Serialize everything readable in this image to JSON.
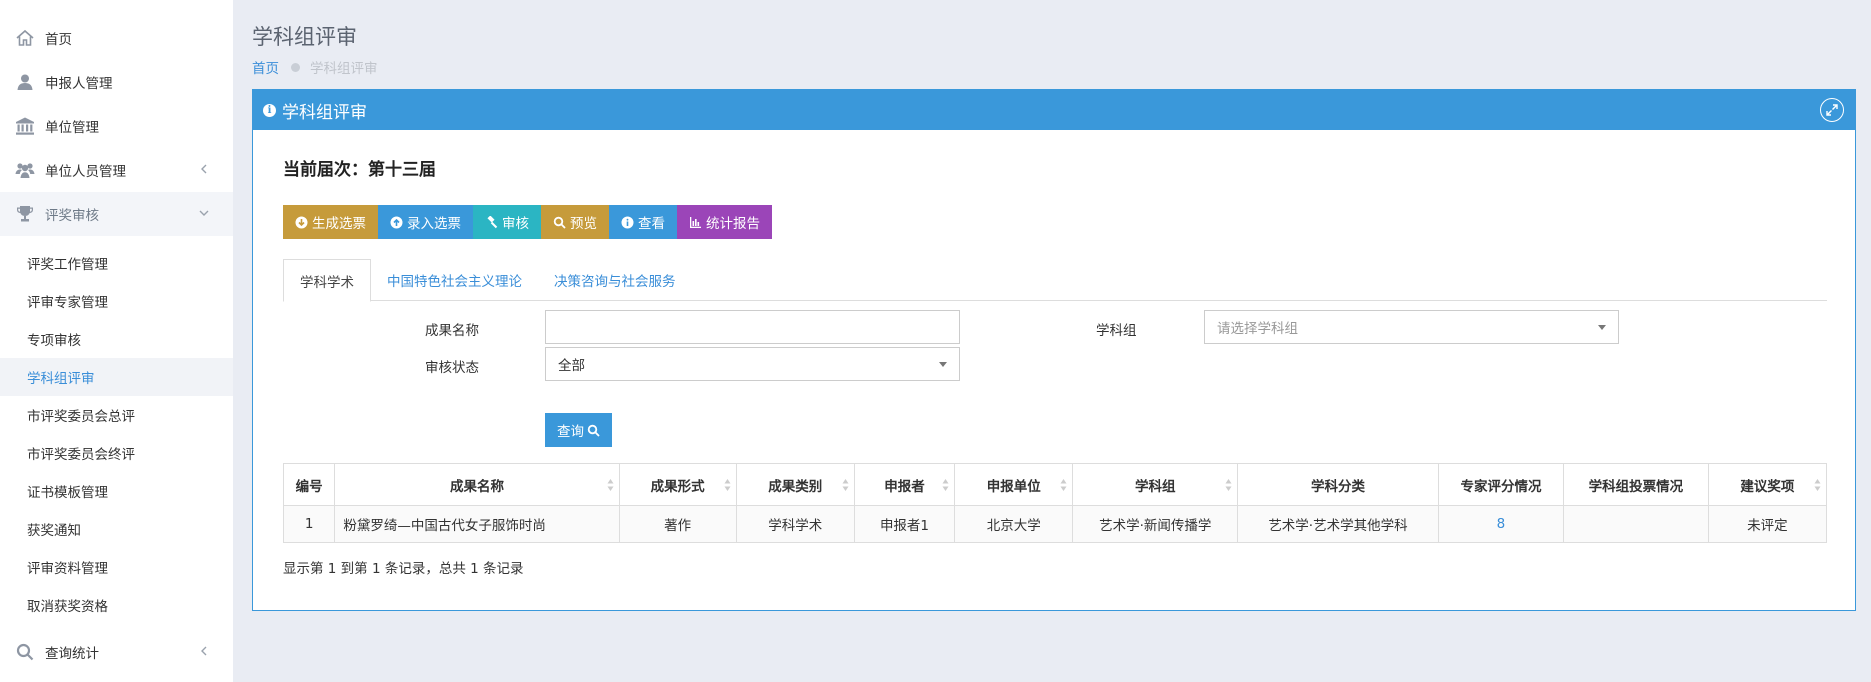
{
  "sidebar": {
    "items": [
      {
        "label": "首页",
        "icon": "home-icon"
      },
      {
        "label": "申报人管理",
        "icon": "user-icon"
      },
      {
        "label": "单位管理",
        "icon": "bank-icon"
      },
      {
        "label": "单位人员管理",
        "icon": "users-icon"
      },
      {
        "label": "评奖审核",
        "icon": "trophy-icon"
      }
    ],
    "sub_items": [
      "评奖工作管理",
      "评审专家管理",
      "专项审核",
      "学科组评审",
      "市评奖委员会总评",
      "市评奖委员会终评",
      "证书模板管理",
      "获奖通知",
      "评审资料管理",
      "取消获奖资格"
    ],
    "bottom_item": {
      "label": "查询统计",
      "icon": "search-icon"
    }
  },
  "header": {
    "title": "学科组评审",
    "breadcrumb_home": "首页",
    "breadcrumb_current": "学科组评审"
  },
  "panel": {
    "title": "学科组评审",
    "round_text": "当前届次：第十三届",
    "buttons": [
      "生成选票",
      "录入选票",
      "审核",
      "预览",
      "查看",
      "统计报告"
    ],
    "tabs": [
      "学科学术",
      "中国特色社会主义理论",
      "决策咨询与社会服务"
    ]
  },
  "form": {
    "name_label": "成果名称",
    "name_value": "",
    "group_label": "学科组",
    "group_placeholder": "请选择学科组",
    "status_label": "审核状态",
    "status_value": "全部",
    "query_label": "查询"
  },
  "table": {
    "headers": [
      "编号",
      "成果名称",
      "成果形式",
      "成果类别",
      "申报者",
      "申报单位",
      "学科组",
      "学科分类",
      "专家评分情况",
      "学科组投票情况",
      "建议奖项"
    ],
    "rows": [
      [
        "1",
        "粉黛罗绮—中国古代女子服饰时尚",
        "著作",
        "学科学术",
        "申报者1",
        "北京大学",
        "艺术学·新闻传播学",
        "艺术学·艺术学其他学科",
        "8",
        "",
        "未评定"
      ]
    ]
  },
  "summary": "显示第 1 到第 1 条记录，总共 1 条记录",
  "colors": {
    "primary": "#3a98da",
    "gold": "#c69b3b",
    "teal": "#2bb5c3",
    "purple": "#9b45b8",
    "link": "#3a8ed8"
  }
}
